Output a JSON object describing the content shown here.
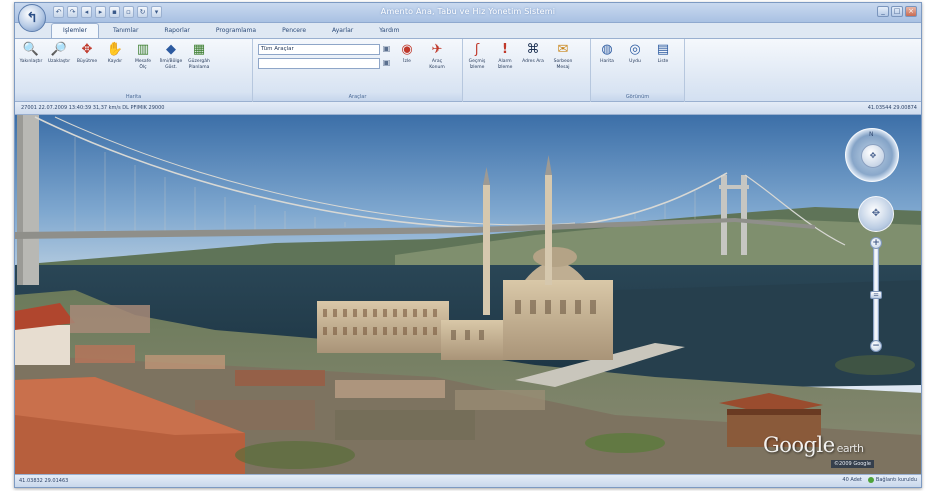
{
  "window": {
    "title": "Amento Ana, Tabu ve Hiz Yonetim Sistemi",
    "app_menu_icon": "app-orb-icon",
    "quick_access": [
      "undo-icon",
      "redo-icon",
      "back-icon",
      "forward-icon",
      "save-icon",
      "print-icon",
      "refresh-icon",
      "settings-icon"
    ],
    "controls": {
      "minimize": "_",
      "maximize": "□",
      "close": "×"
    }
  },
  "tabs": [
    {
      "label": "Işlemler",
      "active": true
    },
    {
      "label": "Tanımlar",
      "active": false
    },
    {
      "label": "Raporlar",
      "active": false
    },
    {
      "label": "Programlama",
      "active": false
    },
    {
      "label": "Pencere",
      "active": false
    },
    {
      "label": "Ayarlar",
      "active": false
    },
    {
      "label": "Yardım",
      "active": false
    }
  ],
  "ribbon": {
    "harita": {
      "label": "Harita",
      "buttons": [
        {
          "label": "Yakınlaştır",
          "icon": "zoom-in-icon",
          "glyph": "🔍",
          "color": "#2c5aa0"
        },
        {
          "label": "Uzaklaştır",
          "icon": "zoom-out-icon",
          "glyph": "🔎",
          "color": "#2c5aa0"
        },
        {
          "label": "Büyütme",
          "icon": "pan-arrows-icon",
          "glyph": "✥",
          "color": "#c0392b"
        },
        {
          "label": "Kaydır",
          "icon": "hand-icon",
          "glyph": "✋",
          "color": "#b07a3a"
        },
        {
          "label": "Mesafe Ölç",
          "icon": "ruler-icon",
          "glyph": "📏",
          "color": "#3a7d2c"
        },
        {
          "label": "İlmi/Bölge Göst.",
          "icon": "region-icon",
          "glyph": "◆",
          "color": "#2c5aa0"
        },
        {
          "label": "Güzergâh Planlama",
          "icon": "route-icon",
          "glyph": "▦",
          "color": "#3a7d2c"
        }
      ]
    },
    "araclar": {
      "label": "Araçlar",
      "vehicle_combo": "Tüm Araçlar",
      "second_combo": "",
      "buttons": [
        {
          "label": "İzle",
          "icon": "track-icon",
          "glyph": "◉",
          "color": "#c0392b"
        },
        {
          "label": "Araç Konum",
          "icon": "vehicle-location-icon",
          "glyph": "✈",
          "color": "#c0392b"
        }
      ]
    },
    "gecmis": {
      "buttons": [
        {
          "label": "Geçmiş İzleme",
          "icon": "history-icon",
          "glyph": "ʃ",
          "color": "#c0392b"
        },
        {
          "label": "Alarm İzleme",
          "icon": "alarm-icon",
          "glyph": "!",
          "color": "#c0392b"
        },
        {
          "label": "Adres Ara",
          "icon": "binoculars-icon",
          "glyph": "⌘",
          "color": "#1f3354"
        },
        {
          "label": "Sorbeon Mesaj",
          "icon": "message-icon",
          "glyph": "✉",
          "color": "#c9861a"
        }
      ]
    },
    "gorunum": {
      "label": "Görünüm",
      "buttons": [
        {
          "label": "Harita",
          "icon": "globe-map-icon",
          "glyph": "◍",
          "color": "#2c5aa0"
        },
        {
          "label": "Uydu",
          "icon": "satellite-icon",
          "glyph": "◎",
          "color": "#2c5aa0"
        },
        {
          "label": "Liste",
          "icon": "list-icon",
          "glyph": "▤",
          "color": "#2c5aa0"
        }
      ]
    }
  },
  "infobar": {
    "left": "27001  22.07.2009 13:40:39  31,37 km/s  DL PFIMIK 29000",
    "right": "41.03544  29.00874"
  },
  "map": {
    "navigation_north": "N",
    "logo": "Google",
    "logo_suffix": "earth",
    "copyright": "©2009 Google"
  },
  "statusbar": {
    "coords": "41.03832  29.01463",
    "vehicle_count": "40 Adet",
    "connection": "Bağlantı kuruldu"
  }
}
